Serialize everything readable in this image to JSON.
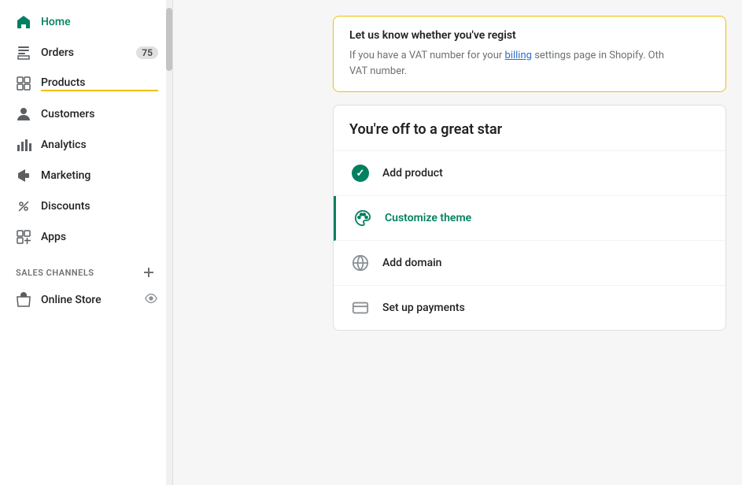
{
  "sidebar": {
    "nav_items": [
      {
        "id": "home",
        "label": "Home",
        "icon": "home",
        "active": true,
        "badge": null
      },
      {
        "id": "orders",
        "label": "Orders",
        "icon": "orders",
        "active": false,
        "badge": "75"
      },
      {
        "id": "products",
        "label": "Products",
        "icon": "products",
        "active": false,
        "badge": null,
        "underline": true
      },
      {
        "id": "customers",
        "label": "Customers",
        "icon": "customers",
        "active": false,
        "badge": null
      },
      {
        "id": "analytics",
        "label": "Analytics",
        "icon": "analytics",
        "active": false,
        "badge": null
      },
      {
        "id": "marketing",
        "label": "Marketing",
        "icon": "marketing",
        "active": false,
        "badge": null
      },
      {
        "id": "discounts",
        "label": "Discounts",
        "icon": "discounts",
        "active": false,
        "badge": null
      },
      {
        "id": "apps",
        "label": "Apps",
        "icon": "apps",
        "active": false,
        "badge": null
      }
    ],
    "sales_channels": {
      "label": "SALES CHANNELS",
      "add_button_title": "Add sales channel",
      "items": [
        {
          "id": "online-store",
          "label": "Online Store",
          "icon": "store"
        }
      ]
    }
  },
  "main": {
    "vat_card": {
      "title": "Let us know whether you've regist",
      "body_part1": "If you have a VAT number for your",
      "body_link": "billing",
      "body_part2": " settings page in Shopify. Oth",
      "body_part3": "VAT number."
    },
    "getting_started": {
      "title": "You're off to a great star",
      "checklist": [
        {
          "id": "add-product",
          "label": "Add product",
          "completed": true,
          "active": false,
          "icon": "check-complete"
        },
        {
          "id": "customize-theme",
          "label": "Customize theme",
          "completed": false,
          "active": true,
          "icon": "customize"
        },
        {
          "id": "add-domain",
          "label": "Add domain",
          "completed": false,
          "active": false,
          "icon": "domain"
        },
        {
          "id": "set-up-payments",
          "label": "Set up payments",
          "completed": false,
          "active": false,
          "icon": "payments"
        }
      ]
    }
  },
  "colors": {
    "active_green": "#008060",
    "badge_bg": "#e0e0e0",
    "border_yellow": "#f0c000",
    "link_blue": "#2c6ecb",
    "active_left_border": "#008060"
  }
}
